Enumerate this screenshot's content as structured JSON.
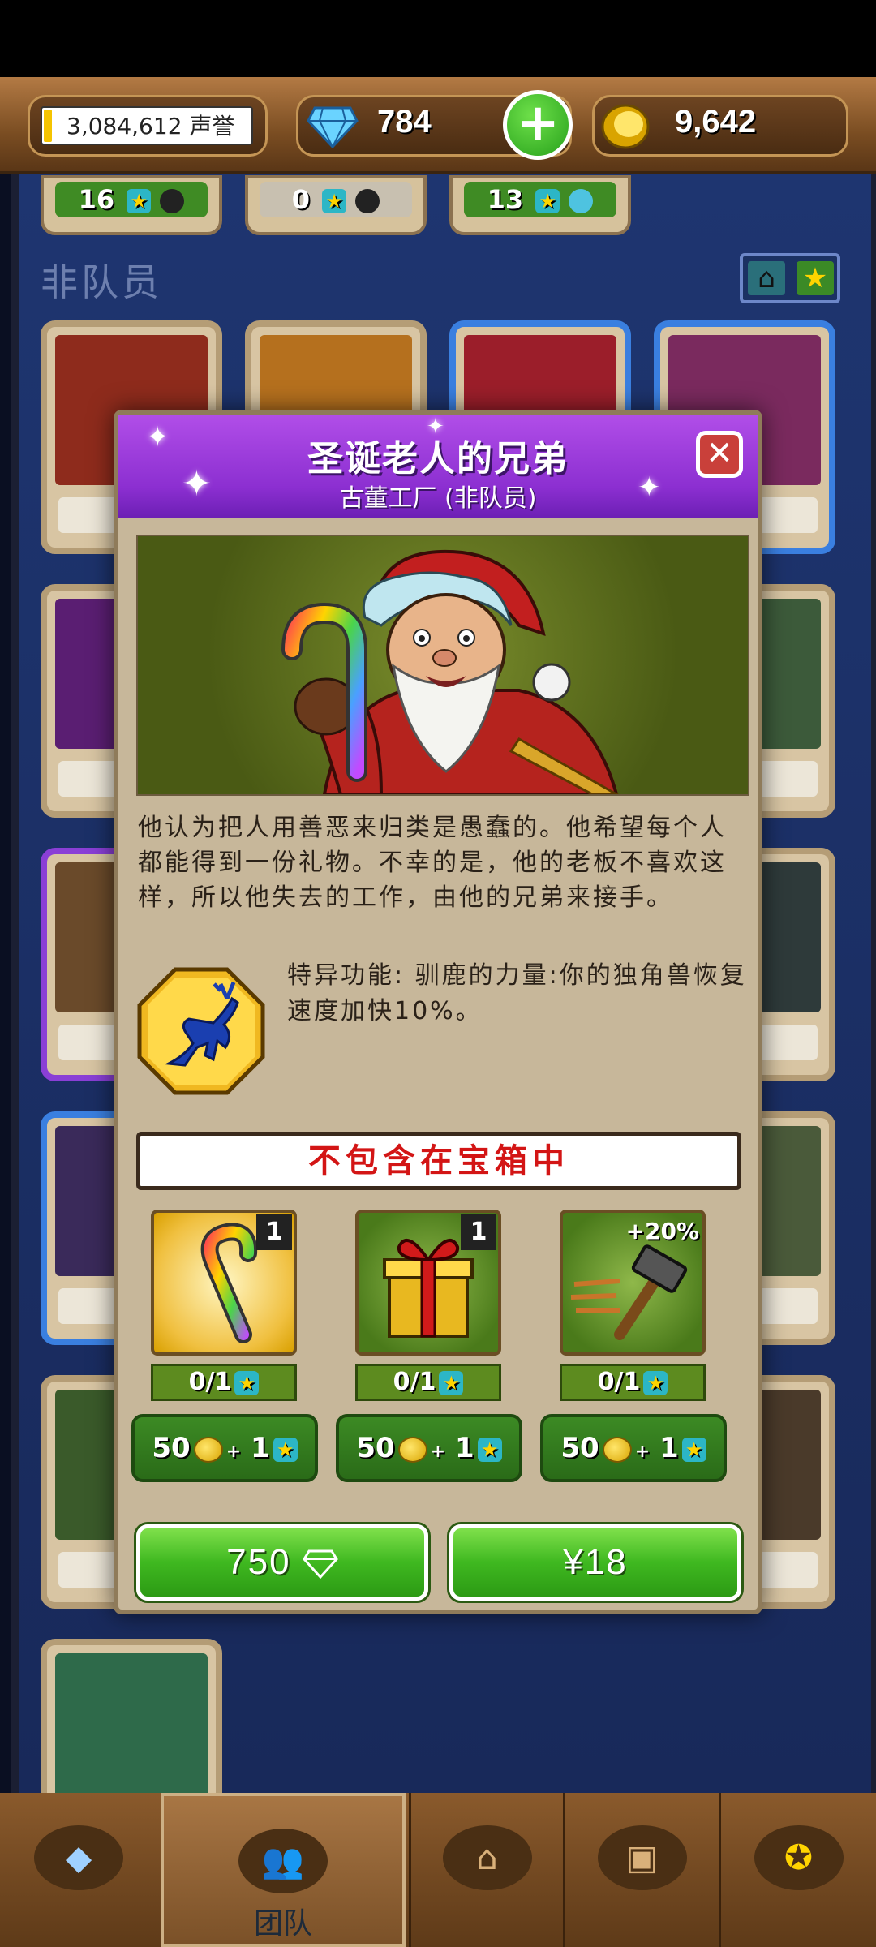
{
  "header": {
    "reputation": "3,084,612 声誉",
    "gems": "784",
    "coins": "9,642"
  },
  "top_strip": [
    {
      "count": "16"
    },
    {
      "count": "0"
    },
    {
      "count": "13"
    }
  ],
  "section": {
    "title": "非队员"
  },
  "modal": {
    "title": "圣诞老人的兄弟",
    "subtitle": "古董工厂 (非队员)",
    "close": "✕",
    "description": "他认为把人用善恶来归类是愚蠢的。他希望每个人都能得到一份礼物。不幸的是，他的老板不喜欢这样，所以他失去的工作，由他的兄弟来接手。",
    "ability": "特异功能: 驯鹿的力量:你的独角兽恢复速度加快10%。",
    "not_in_chest": "不包含在宝箱中",
    "items": [
      {
        "icon": "candy-cane",
        "badge": "1",
        "progress": "0/1",
        "cost_coins": "50",
        "cost_stars": "1"
      },
      {
        "icon": "gift-box",
        "badge": "1",
        "progress": "0/1",
        "cost_coins": "50",
        "cost_stars": "1"
      },
      {
        "icon": "hammer",
        "badge": "+20%",
        "progress": "0/1",
        "cost_coins": "50",
        "cost_stars": "1"
      }
    ],
    "buy_gems": "750",
    "buy_price": "¥18"
  },
  "nav": {
    "team_label": "团队"
  },
  "colors": {
    "accent_green": "#3fb820",
    "modal_purple": "#8c2fd1",
    "warning_red": "#d31515"
  }
}
